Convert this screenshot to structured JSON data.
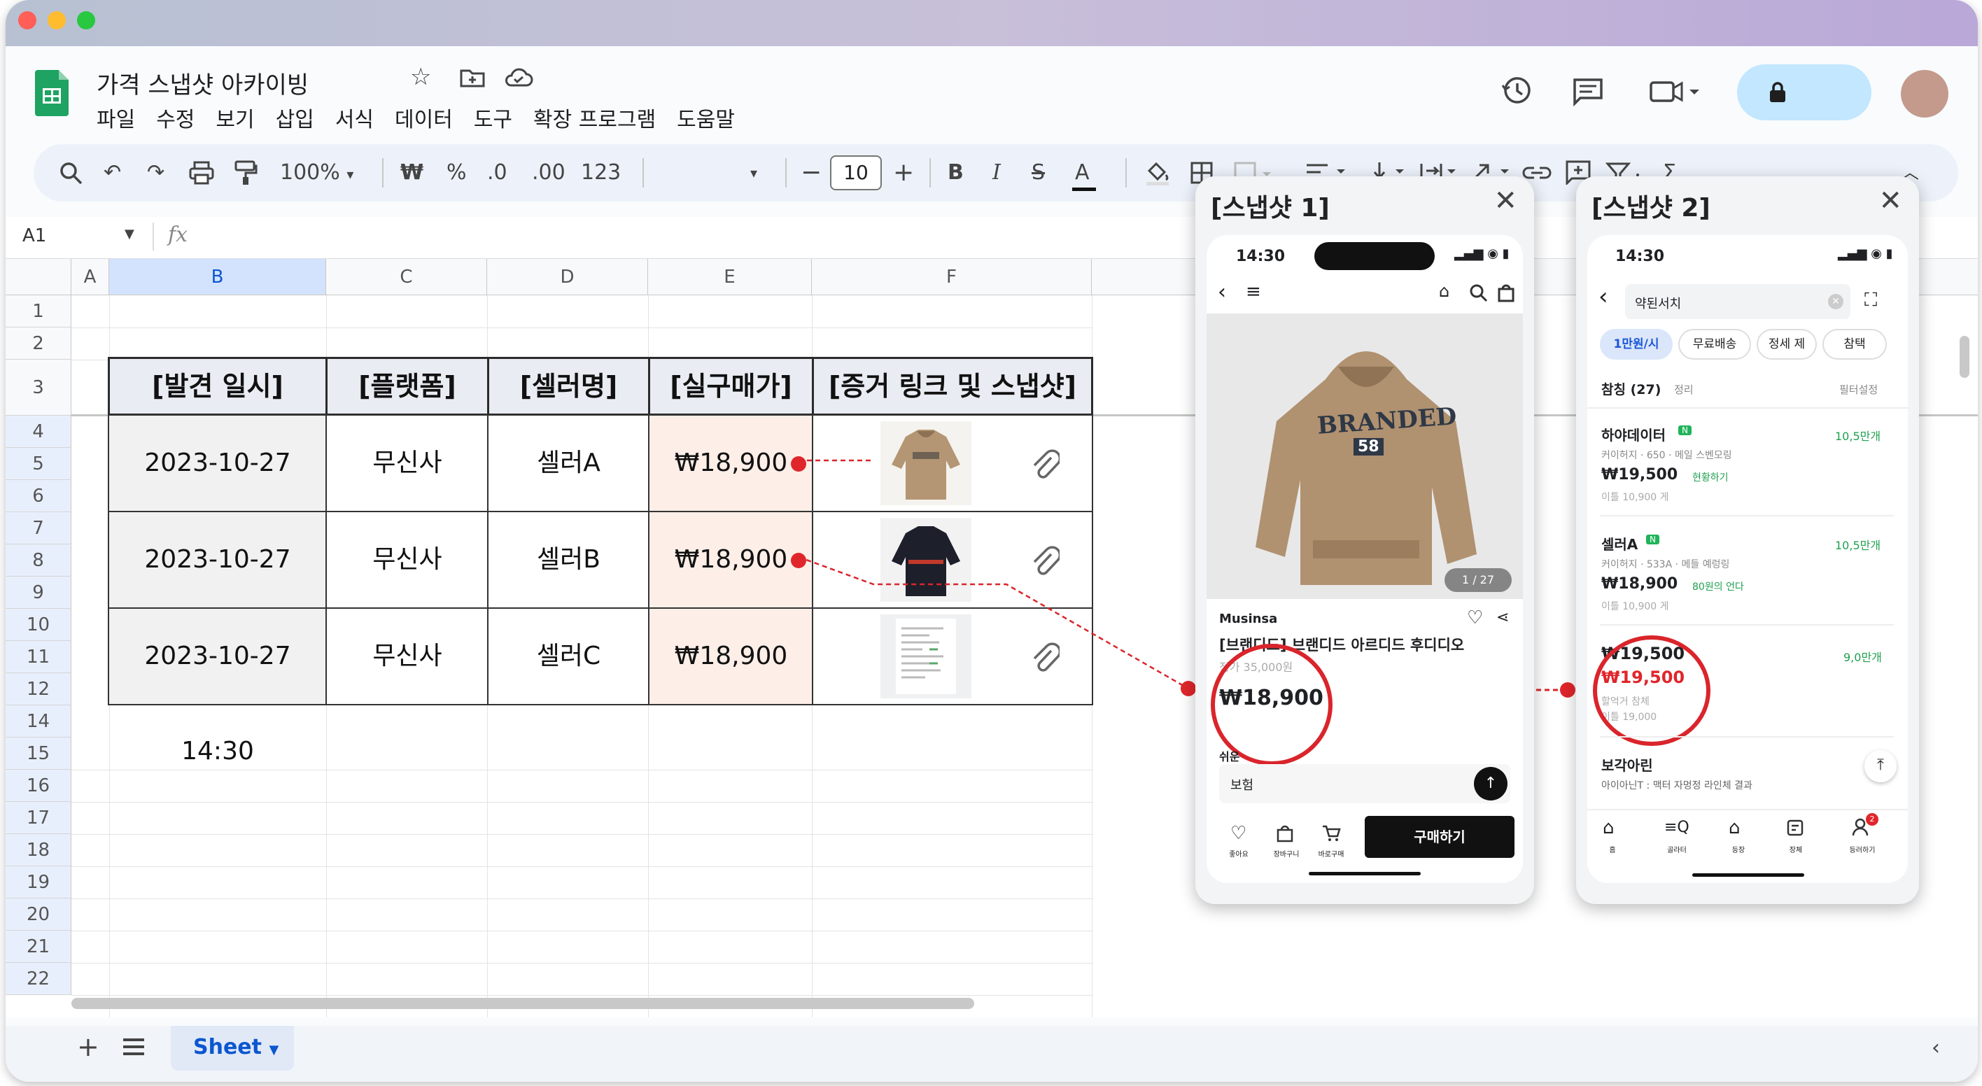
{
  "window": {
    "traffic_lights": [
      "#ff5f57",
      "#febc2e",
      "#28c840"
    ]
  },
  "header": {
    "doc_title": "가격 스냅샷 아카이빙",
    "menu": [
      "파일",
      "수정",
      "보기",
      "삽입",
      "서식",
      "데이터",
      "도구",
      "확장 프로그램",
      "도움말"
    ],
    "icons": [
      "star-icon",
      "move-to-folder-icon",
      "cloud-saved-icon",
      "history-icon",
      "comment-icon",
      "video-call-icon",
      "lock-icon",
      "avatar"
    ],
    "share_color": "#c2e7ff"
  },
  "toolbar": {
    "zoom": "100%",
    "currency": "₩",
    "percent": "%",
    "decrease_decimals": ".0",
    "increase_decimals": ".00",
    "number_format": "123",
    "font_size": "10",
    "bold": "B",
    "italic": "I"
  },
  "formula_bar": {
    "cell_ref": "A1",
    "fx": "fx"
  },
  "grid": {
    "columns": [
      "A",
      "B",
      "C",
      "D",
      "E",
      "F"
    ],
    "rows": [
      "1",
      "2",
      "3",
      "4",
      "5",
      "6",
      "7",
      "8",
      "9",
      "10",
      "11",
      "12",
      "14",
      "15",
      "16",
      "17",
      "18",
      "19",
      "20",
      "21",
      "22"
    ],
    "table_headers": [
      "[발견 일시]",
      "[플랫폼]",
      "[셀러명]",
      "[실구매가]",
      "[증거 링크 및 스냅샷]"
    ],
    "table_rows": [
      {
        "datetime": "2023-10-27 14:30",
        "platform": "무신사",
        "seller": "셀러A",
        "price": "₩18,900",
        "thumbnail": "tan-hoodie-thumbnail"
      },
      {
        "datetime": "2023-10-27 14:30",
        "platform": "무신사",
        "seller": "셀러B",
        "price": "₩18,900",
        "thumbnail": "black-hoodie-thumbnail"
      },
      {
        "datetime": "2023-10-27 14:30",
        "platform": "무신사",
        "seller": "셀러C",
        "price": "₩18,900",
        "thumbnail": "receipt-thumbnail"
      }
    ],
    "highlight_color": "#fdeee8",
    "annotation_color": "#e0262b"
  },
  "sheet_tabs": {
    "active": "Sheet"
  },
  "snapshot1": {
    "title": "[스냅샷 1]",
    "time": "14:30",
    "image_counter": "1 / 27",
    "hoodie_text_1": "BRANDED",
    "hoodie_text_2": "58",
    "brand": "Musinsa",
    "product_name": "[브랜디드] 브랜디드 아르디드 후디디오",
    "sub_text": "정가 35,000원",
    "price": "₩18,900",
    "section_label": "쉬운",
    "input_value": "보험",
    "buy_button": "구매하기",
    "nav_labels": [
      "좋아요",
      "장바구니",
      "바로구매"
    ]
  },
  "snapshot2": {
    "title": "[스냅샷 2]",
    "time": "14:30",
    "search_value": "약된서치",
    "chips": [
      "1만원/시",
      "무료배송",
      "정세 제",
      "참택"
    ],
    "result_count": "참칭 (27)",
    "sort": "정리",
    "filter": "필터설정",
    "items": [
      {
        "seller": "하야데이터",
        "badge": "N",
        "delivery": "10,5만개",
        "meta": "커이허지 · 650 · 메일 스벤모링",
        "price": "₩19,500",
        "note": "현황하기",
        "sub": "이틀 10,900 게"
      },
      {
        "seller": "셀러A",
        "badge": "N",
        "delivery": "10,5만개",
        "meta": "커이허지 · 533A · 메들 예렁링",
        "price": "₩18,900",
        "note": "80원의 언다",
        "sub": "이틀 10,900 게"
      },
      {
        "seller": "",
        "badge": "",
        "delivery": "9,0만개",
        "meta": "",
        "price": "₩19,500",
        "price_red": "₩19,500",
        "note": "할억거 참체",
        "sub": "이틀 19,000"
      },
      {
        "seller": "보각아린",
        "badge": "",
        "delivery": "",
        "meta": "아이아닌T : 맥터 자멍정 라인체 결과",
        "price": "",
        "note": "",
        "sub": ""
      }
    ],
    "nav_labels": [
      "홈",
      "골라터",
      "등장",
      "장체",
      "등러하기"
    ],
    "notif_count": "2"
  }
}
